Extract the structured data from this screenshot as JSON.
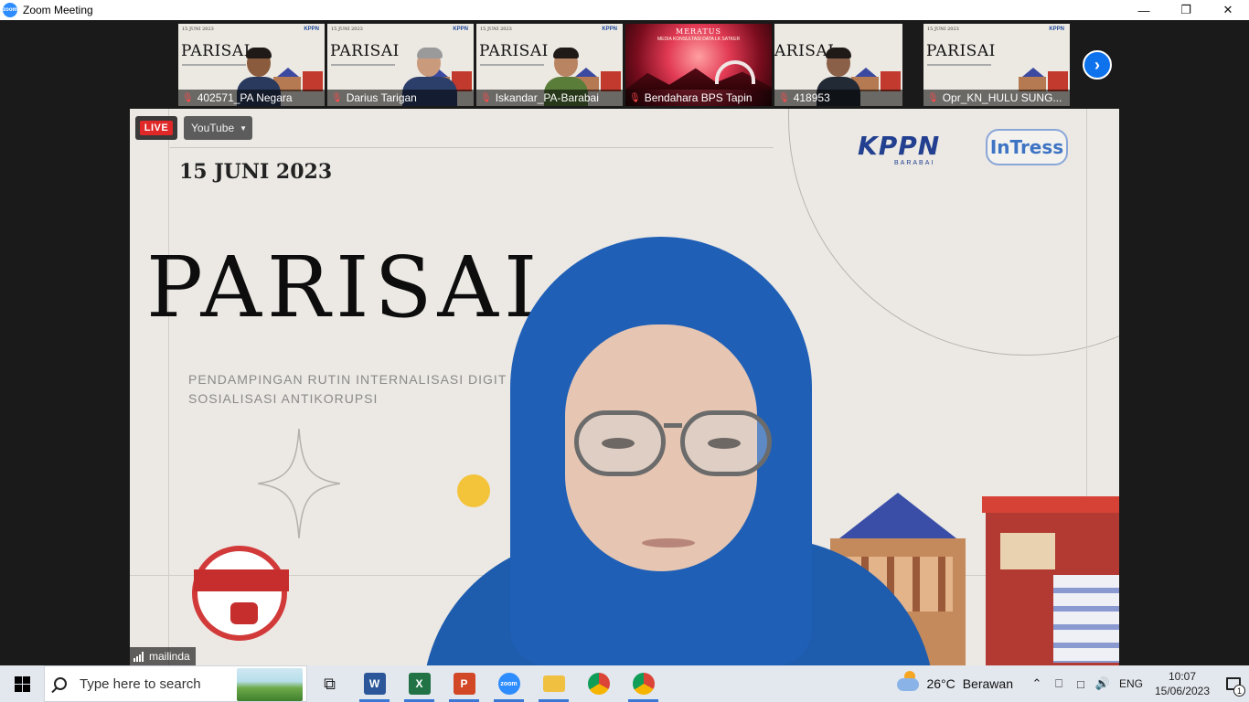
{
  "window": {
    "title": "Zoom Meeting",
    "app_icon_text": "zoom",
    "controls": [
      "minimize-icon",
      "restore-icon",
      "close-icon"
    ]
  },
  "thumbnails": [
    {
      "name": "402571_PA Negara",
      "slide_title": "PARISAI",
      "slide_date": "15 JUNI 2023",
      "brand": "KPPN",
      "muted": true
    },
    {
      "name": "Darius Tarigan",
      "slide_title": "PARISAI",
      "slide_date": "15 JUNI 2023",
      "brand": "KPPN",
      "muted": true
    },
    {
      "name": "Iskandar_PA-Barabai",
      "slide_title": "PARISAI",
      "slide_date": "15 JUNI 2023",
      "brand": "KPPN",
      "muted": true
    },
    {
      "name": "Bendahara BPS Tapin",
      "slide_title": "MERATUS",
      "slide_subtitle": "MEDIA KONSULTASI DATA LK SATKER",
      "muted": true
    },
    {
      "name": "418953",
      "slide_title": "ARISAI",
      "muted": true
    },
    {
      "name": "Opr_KN_HULU SUNG...",
      "slide_title": "PARISAI",
      "slide_date": "15 JUNI 2023",
      "brand": "KPPN",
      "muted": true
    }
  ],
  "next_button_icon": "chevron-right-icon",
  "main_video": {
    "live_label": "LIVE",
    "stream_target": "YouTube",
    "slide": {
      "date": "15 JUNI 2023",
      "title": "PARISAI",
      "subtitle_line1": "PENDAMPINGAN RUTIN INTERNALISASI DIGIT",
      "subtitle_line2": "SOSIALISASI ANTIKORUPSI",
      "logo_kppn": "KPPN",
      "logo_kppn_sub": "BARABAI",
      "logo_intress": "InTress"
    },
    "speaker_name": "mailinda"
  },
  "taskbar": {
    "search_placeholder": "Type here to search",
    "apps": [
      {
        "name": "task-view-icon",
        "label": ""
      },
      {
        "name": "word-icon",
        "label": "W",
        "color": "#2b579a"
      },
      {
        "name": "excel-icon",
        "label": "X",
        "color": "#217346"
      },
      {
        "name": "powerpoint-icon",
        "label": "P",
        "color": "#d24726"
      },
      {
        "name": "zoom-icon",
        "label": "zoom",
        "color": "#2d8cff"
      },
      {
        "name": "file-explorer-icon",
        "label": "",
        "color": "#f0c040"
      },
      {
        "name": "chrome-icon",
        "label": "",
        "color": "#db4437"
      },
      {
        "name": "chrome-profile-icon",
        "label": "",
        "color": "#db4437"
      }
    ],
    "weather_temp": "26°C",
    "weather_condition": "Berawan",
    "language": "ENG",
    "time": "10:07",
    "date": "15/06/2023",
    "notification_count": "1"
  }
}
